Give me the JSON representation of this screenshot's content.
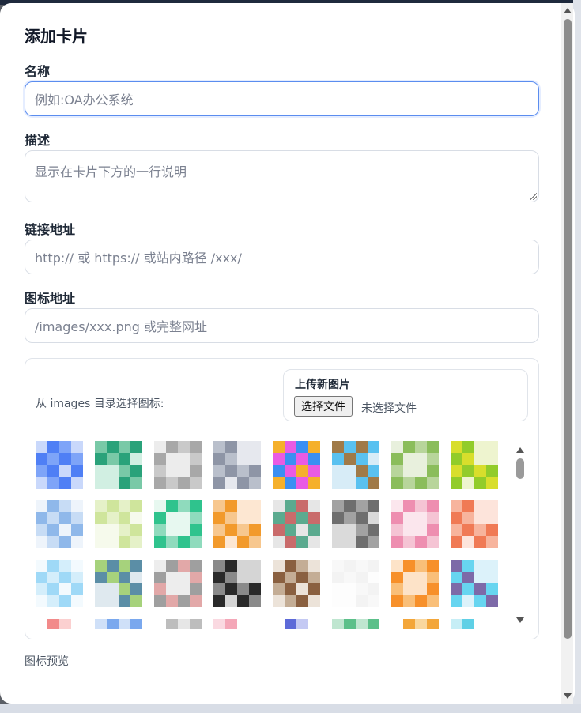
{
  "dialog": {
    "title": "添加卡片"
  },
  "form": {
    "name": {
      "label": "名称",
      "placeholder": "例如:OA办公系统",
      "value": ""
    },
    "description": {
      "label": "描述",
      "placeholder": "显示在卡片下方的一行说明",
      "value": ""
    },
    "link": {
      "label": "链接地址",
      "placeholder": "http:// 或 https:// 或站内路径 /xxx/",
      "value": ""
    },
    "icon_url": {
      "label": "图标地址",
      "placeholder": "/images/xxx.png 或完整网址",
      "value": ""
    }
  },
  "icon_picker": {
    "hint": "从 images 目录选择图标:",
    "upload": {
      "title": "上传新图片",
      "button_label": "选择文件",
      "status": "未选择文件"
    },
    "icons": [
      {
        "name": "icon-blue-tiles",
        "colors": [
          "#4f7ff5",
          "#7ea4f8",
          "#c9d8fb"
        ]
      },
      {
        "name": "icon-green-grid",
        "colors": [
          "#2aa27a",
          "#79c9a7",
          "#d1efe2"
        ]
      },
      {
        "name": "icon-grey-blocks",
        "colors": [
          "#a8a8a8",
          "#c9c9c9",
          "#ececec"
        ]
      },
      {
        "name": "icon-slate-blocks",
        "colors": [
          "#8e95a6",
          "#b9bfcb",
          "#e6e8ee"
        ]
      },
      {
        "name": "icon-rainbow",
        "colors": [
          "#e95be3",
          "#3b8ff2",
          "#f5b02b"
        ]
      },
      {
        "name": "icon-sky-brown",
        "colors": [
          "#59c1f0",
          "#a07a48",
          "#d7ecf7"
        ]
      },
      {
        "name": "icon-olive-green",
        "colors": [
          "#8bbd5b",
          "#b8d59b",
          "#e8f0dd"
        ]
      },
      {
        "name": "icon-lime-yellow",
        "colors": [
          "#92cc2a",
          "#d8de2c",
          "#eef4cf"
        ]
      },
      {
        "name": "icon-light-blue",
        "colors": [
          "#8fb8ea",
          "#c7dcf5",
          "#eef4fb"
        ]
      },
      {
        "name": "icon-pale-lime",
        "colors": [
          "#cfe59c",
          "#e5f1c8",
          "#f6faec"
        ]
      },
      {
        "name": "icon-green-frame",
        "colors": [
          "#2fc38d",
          "#8fdbbd",
          "#e7f8f0"
        ]
      },
      {
        "name": "icon-orange-peach",
        "colors": [
          "#f29a2c",
          "#f7c78e",
          "#fde7d2"
        ]
      },
      {
        "name": "icon-mixed-muted",
        "colors": [
          "#5baa8f",
          "#c96b6b",
          "#e6e6e6"
        ]
      },
      {
        "name": "icon-dark-grey",
        "colors": [
          "#6e6e6e",
          "#a2a2a2",
          "#dadada"
        ]
      },
      {
        "name": "icon-pink-blocks",
        "colors": [
          "#ee8eb0",
          "#f5c4d4",
          "#fbe6ed"
        ]
      },
      {
        "name": "icon-coral",
        "colors": [
          "#f07a55",
          "#f7b49d",
          "#fde4db"
        ]
      },
      {
        "name": "icon-ice-blue",
        "colors": [
          "#9fd9f7",
          "#d4eefb",
          "#f3fafe"
        ]
      },
      {
        "name": "icon-teal-mix",
        "colors": [
          "#5b8ea6",
          "#a6d27c",
          "#dfe9ef"
        ]
      },
      {
        "name": "icon-grey-rose",
        "colors": [
          "#9f9f9f",
          "#e2a8a8",
          "#ededed"
        ]
      },
      {
        "name": "icon-black-grey",
        "colors": [
          "#2a2a2a",
          "#8a8a8a",
          "#d5d5d5"
        ]
      },
      {
        "name": "icon-brown",
        "colors": [
          "#8a6040",
          "#c4ad95",
          "#ece3d9"
        ]
      },
      {
        "name": "icon-white-blank",
        "colors": [
          "#f3f3f3",
          "#f8f8f8",
          "#fdfdfd"
        ]
      },
      {
        "name": "icon-orange-cross",
        "colors": [
          "#f7902a",
          "#f9bf79",
          "#fde3c8"
        ]
      },
      {
        "name": "icon-cyan-purple",
        "colors": [
          "#67d5f0",
          "#7d6aa8",
          "#dcf2fa"
        ]
      },
      {
        "name": "icon-partial-red",
        "colors": [
          "#f28a8a",
          "#fbd0d0",
          "#ffffff"
        ]
      },
      {
        "name": "icon-partial-blue",
        "colors": [
          "#7aa8ee",
          "#cfe0f8",
          "#ffffff"
        ]
      },
      {
        "name": "icon-partial-grey",
        "colors": [
          "#bdbdbd",
          "#e6e6e6",
          "#ffffff"
        ]
      },
      {
        "name": "icon-partial-pink",
        "colors": [
          "#f4a7b8",
          "#fad9e1",
          "#ffffff"
        ]
      },
      {
        "name": "icon-partial-indigo",
        "colors": [
          "#5d6ad8",
          "#c4c9f3",
          "#ffffff"
        ]
      },
      {
        "name": "icon-partial-green",
        "colors": [
          "#5cc08a",
          "#bfe6d0",
          "#ffffff"
        ]
      },
      {
        "name": "icon-partial-amber",
        "colors": [
          "#f3a63a",
          "#f9d79e",
          "#ffffff"
        ]
      },
      {
        "name": "icon-partial-aqua",
        "colors": [
          "#5fd0e6",
          "#c6eef6",
          "#ffffff"
        ]
      }
    ]
  },
  "preview": {
    "label": "图标预览"
  }
}
